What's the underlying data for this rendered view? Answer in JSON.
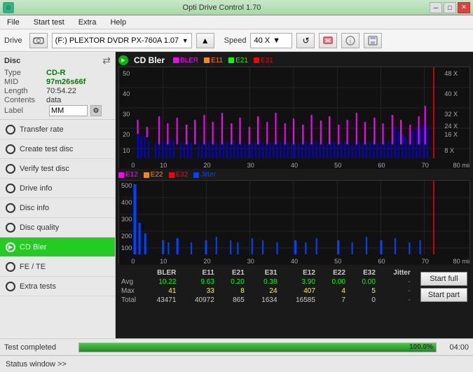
{
  "titlebar": {
    "title": "Opti Drive Control 1.70",
    "icon": "disc-icon"
  },
  "menubar": {
    "items": [
      "File",
      "Start test",
      "Extra",
      "Help"
    ]
  },
  "drivebar": {
    "label": "Drive",
    "drive_value": "(F:)  PLEXTOR DVDR   PX-760A 1.07",
    "speed_label": "Speed",
    "speed_value": "40 X"
  },
  "disc": {
    "title": "Disc",
    "type_label": "Type",
    "type_value": "CD-R",
    "mid_label": "MID",
    "mid_value": "97m26s66f",
    "length_label": "Length",
    "length_value": "70:54.22",
    "contents_label": "Contents",
    "contents_value": "data",
    "label_label": "Label",
    "label_value": "MM"
  },
  "sidebar": {
    "items": [
      {
        "id": "transfer-rate",
        "label": "Transfer rate",
        "active": false
      },
      {
        "id": "create-test-disc",
        "label": "Create test disc",
        "active": false
      },
      {
        "id": "verify-test-disc",
        "label": "Verify test disc",
        "active": false
      },
      {
        "id": "drive-info",
        "label": "Drive info",
        "active": false
      },
      {
        "id": "disc-info",
        "label": "Disc info",
        "active": false
      },
      {
        "id": "disc-quality",
        "label": "Disc quality",
        "active": false
      },
      {
        "id": "cd-bler",
        "label": "CD Bler",
        "active": true
      },
      {
        "id": "fe-te",
        "label": "FE / TE",
        "active": false
      },
      {
        "id": "extra-tests",
        "label": "Extra tests",
        "active": false
      }
    ]
  },
  "chart1": {
    "title": "CD Bler",
    "legend": [
      {
        "label": "BLER",
        "color": "#ff00ff"
      },
      {
        "label": "E11",
        "color": "#ff6600"
      },
      {
        "label": "E21",
        "color": "#00cc00"
      },
      {
        "label": "E31",
        "color": "#ff0000"
      }
    ],
    "y_max": 50,
    "x_max": 80,
    "right_labels": [
      "48 X",
      "40 X",
      "32 X",
      "24 X",
      "16 X",
      "8 X"
    ]
  },
  "chart2": {
    "legend": [
      {
        "label": "E12",
        "color": "#ff00ff"
      },
      {
        "label": "E22",
        "color": "#ff6600"
      },
      {
        "label": "E32",
        "color": "#ff0000"
      },
      {
        "label": "Jitter",
        "color": "#0066ff"
      }
    ],
    "y_max": 500,
    "x_max": 80
  },
  "stats": {
    "headers": [
      "BLER",
      "E11",
      "E21",
      "E31",
      "E12",
      "E22",
      "E32",
      "Jitter"
    ],
    "avg_label": "Avg",
    "avg_values": [
      "10.22",
      "9.63",
      "0.20",
      "0.38",
      "3.90",
      "0.00",
      "0.00",
      "-"
    ],
    "max_label": "Max",
    "max_values": [
      "41",
      "33",
      "8",
      "24",
      "407",
      "4",
      "5",
      "-"
    ],
    "total_label": "Total",
    "total_values": [
      "43471",
      "40972",
      "865",
      "1634",
      "16585",
      "7",
      "0",
      "-"
    ]
  },
  "buttons": {
    "start_full": "Start full",
    "start_part": "Start part"
  },
  "statusbar": {
    "status_text": "Test completed",
    "progress": 100.0,
    "progress_label": "100.0%",
    "time": "04:00"
  },
  "bottom_status": {
    "label": "Status window >>",
    "show_label": "Status window >>"
  }
}
